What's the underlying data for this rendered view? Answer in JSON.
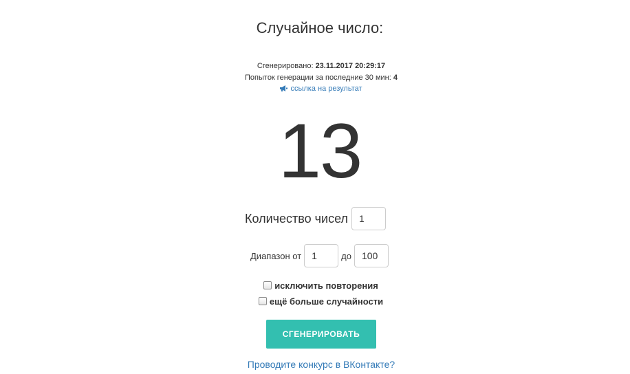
{
  "header": {
    "title": "Случайное число:"
  },
  "meta": {
    "generated_label": "Сгенерировано:",
    "generated_value": "23.11.2017 20:29:17",
    "attempts_label": "Попыток генерации за последние 30 мин:",
    "attempts_value": "4",
    "result_link": "ссылка на результат",
    "result_link_icon": "megaphone-icon"
  },
  "result": {
    "value": "13"
  },
  "form": {
    "count_label": "Количество чисел",
    "count_value": "1",
    "range_from_label": "Диапазон от",
    "range_from_value": "1",
    "range_to_label": "до",
    "range_to_value": "100",
    "exclude_repeats_label": "исключить повторения",
    "more_random_label": "ещё больше случайности",
    "generate_button": "СГЕНЕРИРОВАТЬ"
  },
  "footer": {
    "vk_link": "Проводите конкурс в ВКонтакте?"
  },
  "colors": {
    "button": "#33bfb0",
    "link": "#337ab7",
    "text": "#333333"
  }
}
